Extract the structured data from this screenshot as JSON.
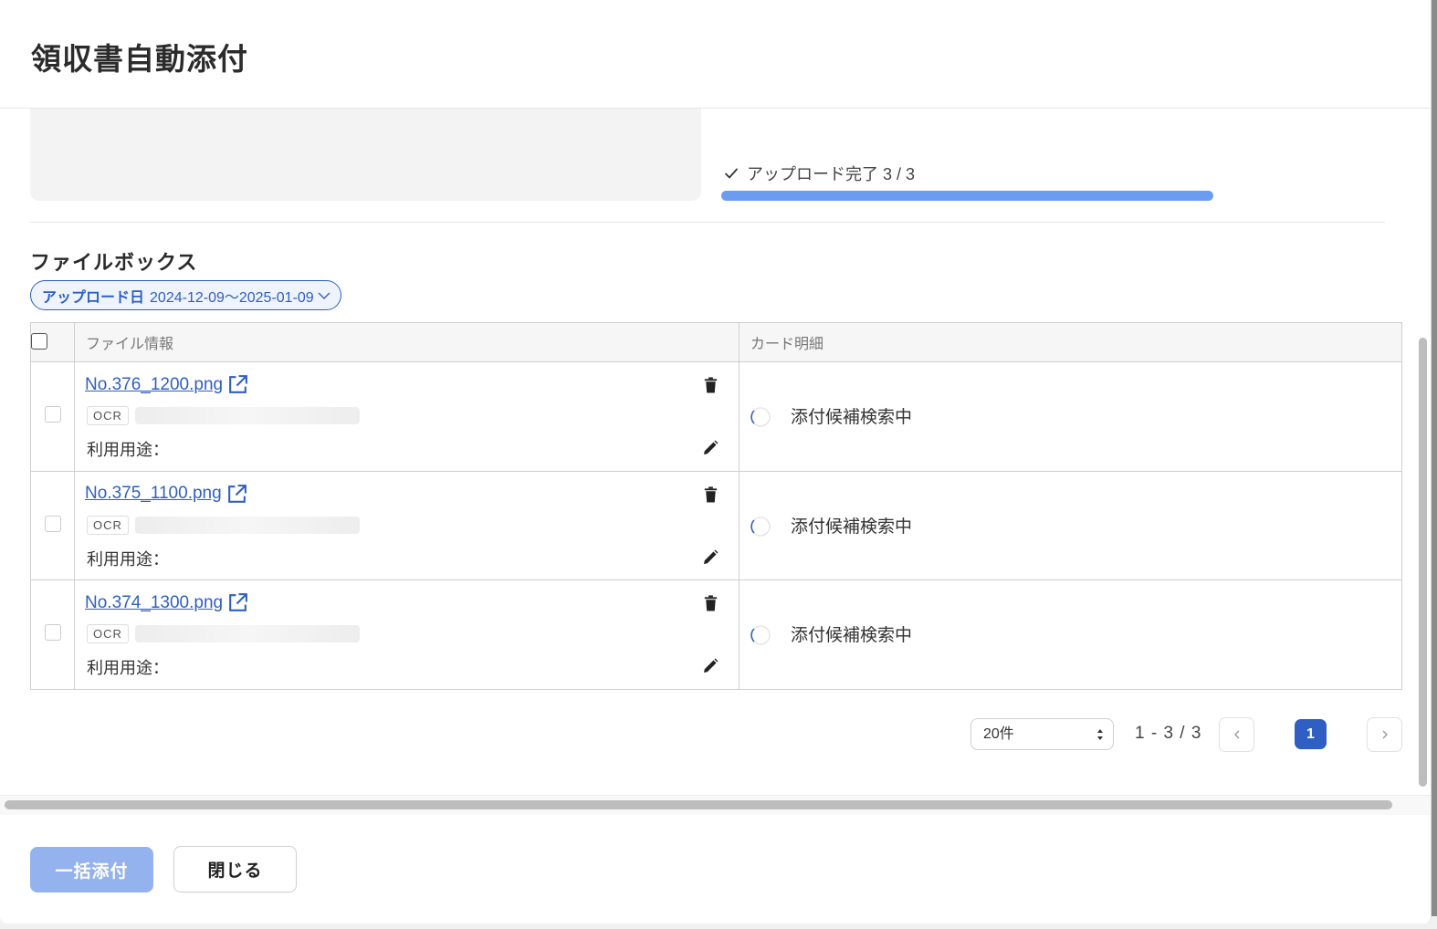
{
  "modal": {
    "title": "領収書自動添付"
  },
  "upload": {
    "status_text": "アップロード完了 3 / 3",
    "progress": 1.0,
    "accent_color": "#6c9cf2"
  },
  "filebox": {
    "title": "ファイルボックス",
    "filter": {
      "label": "アップロード日",
      "value": "2024-12-09〜2025-01-09"
    },
    "columns": [
      "ファイル情報",
      "カード明細"
    ],
    "rows": [
      {
        "file_name": "No.376_1200.png",
        "ocr_label": "OCR",
        "usage_label": "利用用途：",
        "card_status": "添付候補検索中"
      },
      {
        "file_name": "No.375_1100.png",
        "ocr_label": "OCR",
        "usage_label": "利用用途：",
        "card_status": "添付候補検索中"
      },
      {
        "file_name": "No.374_1300.png",
        "ocr_label": "OCR",
        "usage_label": "利用用途：",
        "card_status": "添付候補検索中"
      }
    ]
  },
  "pagination": {
    "per_page": "20件",
    "range": "1 - 3 / 3",
    "current_page": "1",
    "accent_color": "#2f5fc2"
  },
  "footer": {
    "bulk_attach_label": "一括添付",
    "close_label": "閉じる"
  },
  "icons": {
    "check": "check-icon",
    "external": "external-link-icon",
    "trash": "trash-icon",
    "pencil": "pencil-icon",
    "spinner": "spinner-icon",
    "chevron_down": "chevron-down-icon",
    "chevron_left": "chevron-left-icon",
    "chevron_right": "chevron-right-icon"
  }
}
